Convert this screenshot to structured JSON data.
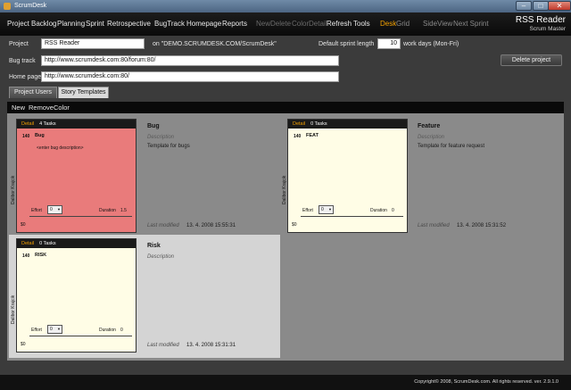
{
  "window": {
    "title": "ScrumDesk",
    "minimize": "–",
    "maximize": "□",
    "close": "✕"
  },
  "menu": {
    "items": [
      {
        "label": "Project",
        "state": "active"
      },
      {
        "label": "Backlog",
        "state": "normal"
      },
      {
        "label": "Planning",
        "state": "normal"
      },
      {
        "label": "Sprint",
        "state": "normal"
      },
      {
        "label": "Retrospective",
        "state": "normal"
      },
      {
        "label": "BugTrack",
        "state": "normal"
      },
      {
        "label": "Homepage",
        "state": "normal"
      },
      {
        "label": "Reports",
        "state": "normal"
      },
      {
        "label": "New",
        "state": "disabled"
      },
      {
        "label": "Delete",
        "state": "disabled"
      },
      {
        "label": "Color",
        "state": "disabled"
      },
      {
        "label": "Detail",
        "state": "disabled"
      },
      {
        "label": "Refresh",
        "state": "normal"
      },
      {
        "label": "Tools",
        "state": "normal"
      },
      {
        "label": "Desk",
        "state": "active"
      },
      {
        "label": "Grid",
        "state": "dim"
      },
      {
        "label": "SideView",
        "state": "dim"
      },
      {
        "label": "Next Sprint",
        "state": "dim"
      }
    ],
    "brand_name": "RSS Reader",
    "brand_role": "Scrum Master"
  },
  "form": {
    "project_label": "Project",
    "project_value": "RSS Reader",
    "project_on": "on \"DEMO.SCRUMDESK.COM/ScrumDesk\"",
    "sprint_length_label": "Default sprint length",
    "sprint_length_value": "10",
    "sprint_length_unit": "work days (Mon-Fri)",
    "bugtrack_label": "Bug track",
    "bugtrack_value": "http://www.scrumdesk.com:80/forum:80/",
    "homepage_label": "Home page",
    "homepage_value": "http://www.scrumdesk.com:80/",
    "delete_button": "Delete project"
  },
  "tabs": [
    {
      "label": "Project Users",
      "active": false
    },
    {
      "label": "Story Templates",
      "active": true
    }
  ],
  "toolbar": {
    "new": "New",
    "remove": "Remove",
    "color": "Color"
  },
  "templates": [
    {
      "card": {
        "detail": "Detail",
        "tasks": "4 Tasks",
        "num": "140",
        "code": "Bug",
        "desc": "<enter bug description>",
        "owner": "Dalibor Krajcik",
        "effort_label": "Effort",
        "effort": "0",
        "duration_label": "Duration",
        "duration": "1.5",
        "money": "$0"
      },
      "title": "Bug",
      "desc_label": "Description",
      "desc": "Template for bugs",
      "modified_label": "Last modified",
      "modified": "13. 4. 2008 15:55:31"
    },
    {
      "card": {
        "detail": "Detail",
        "tasks": "0 Tasks",
        "num": "140",
        "code": "FEAT",
        "desc": "",
        "owner": "Dalibor Krajcik",
        "effort_label": "Effort",
        "effort": "0",
        "duration_label": "Duration",
        "duration": "0",
        "money": "$0"
      },
      "title": "Feature",
      "desc_label": "Description",
      "desc": "Template for feature request",
      "modified_label": "Last modified",
      "modified": "13. 4. 2008 15:31:52"
    },
    {
      "card": {
        "detail": "Detail",
        "tasks": "0 Tasks",
        "num": "140",
        "code": "RISK",
        "desc": "",
        "owner": "Dalibor Krajcik",
        "effort_label": "Effort",
        "effort": "0",
        "duration_label": "Duration",
        "duration": "0",
        "money": "$0"
      },
      "title": "Risk",
      "desc_label": "Description",
      "desc": "",
      "modified_label": "Last modified",
      "modified": "13. 4. 2008 15:31:31"
    }
  ],
  "footer": {
    "copyright": "Copyright© 2008, ScrumDesk.com. All rights reserved. ver. 2.9.1.0"
  },
  "colors": {
    "accent": "#f2a000",
    "bug_card": "#e97b7b",
    "card": "#fffde6"
  }
}
